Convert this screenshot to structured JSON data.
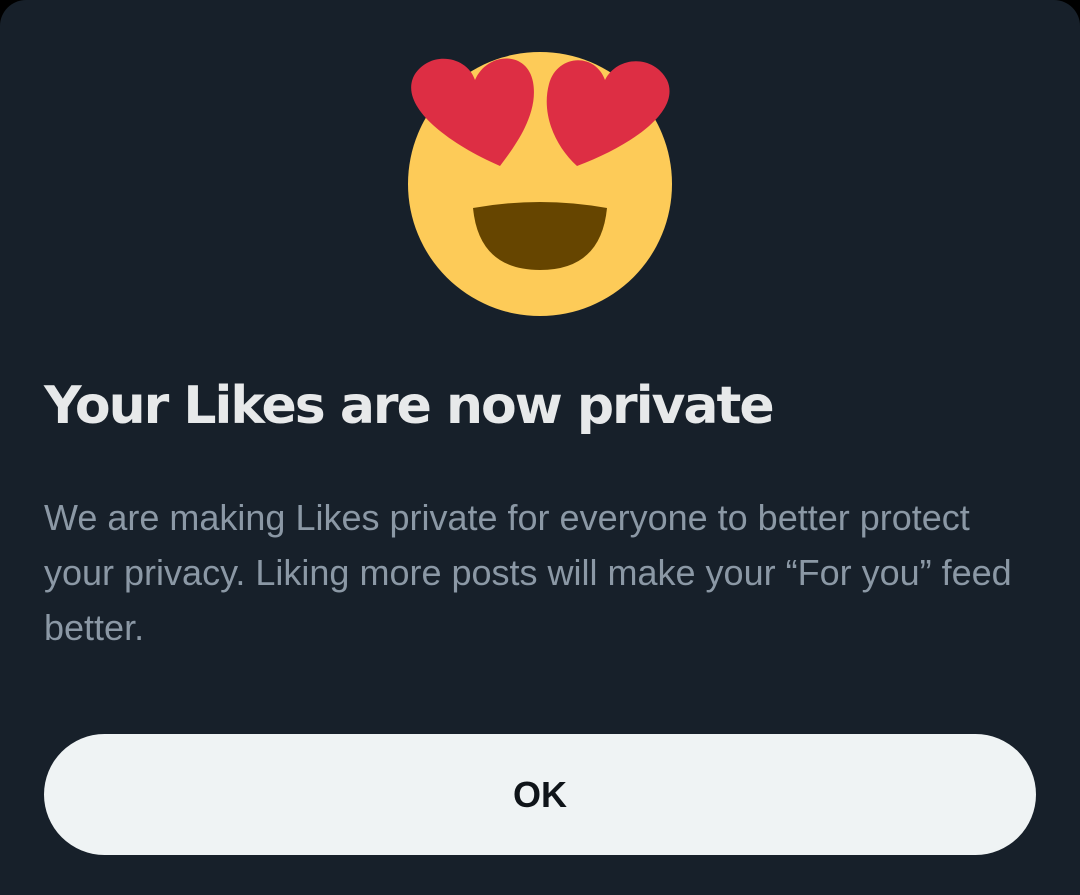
{
  "dialog": {
    "icon": "heart-eyes-emoji-icon",
    "title": "Your Likes are now private",
    "body": "We are making Likes private for everyone to better protect your privacy. Liking more posts will make your “For you” feed better.",
    "ok_label": "OK"
  },
  "colors": {
    "background": "#17202a",
    "title": "#e7e9ea",
    "body_text": "#8b98a5",
    "button_bg": "#eff3f4",
    "button_text": "#0f1419",
    "emoji_face": "#fdcb58",
    "emoji_hearts": "#dd2e44",
    "emoji_mouth": "#664500"
  }
}
